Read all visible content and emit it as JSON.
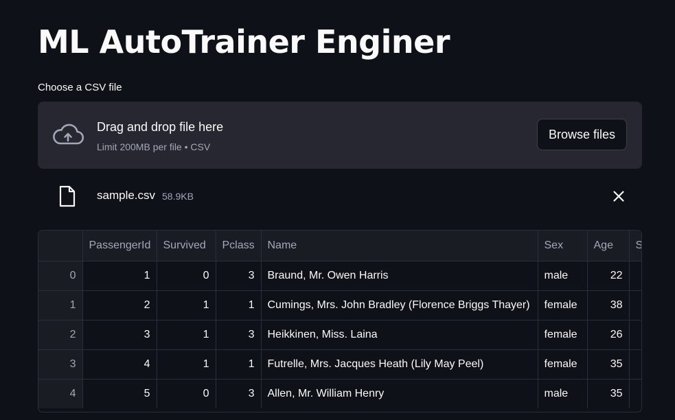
{
  "app": {
    "title": "ML AutoTrainer Enginer"
  },
  "uploader": {
    "label": "Choose a CSV file",
    "drop_title": "Drag and drop file here",
    "drop_subtitle": "Limit 200MB per file • CSV",
    "browse_label": "Browse files",
    "icon": "cloud-upload-icon"
  },
  "uploaded_file": {
    "name": "sample.csv",
    "size": "58.9KB",
    "icon": "file-icon",
    "remove_icon": "close-icon"
  },
  "table": {
    "columns": [
      "",
      "PassengerId",
      "Survived",
      "Pclass",
      "Name",
      "Sex",
      "Age",
      "S"
    ],
    "rows": [
      {
        "index": "0",
        "PassengerId": "1",
        "Survived": "0",
        "Pclass": "3",
        "Name": "Braund, Mr. Owen Harris",
        "Sex": "male",
        "Age": "22"
      },
      {
        "index": "1",
        "PassengerId": "2",
        "Survived": "1",
        "Pclass": "1",
        "Name": "Cumings, Mrs. John Bradley (Florence Briggs Thayer)",
        "Sex": "female",
        "Age": "38"
      },
      {
        "index": "2",
        "PassengerId": "3",
        "Survived": "1",
        "Pclass": "3",
        "Name": "Heikkinen, Miss. Laina",
        "Sex": "female",
        "Age": "26"
      },
      {
        "index": "3",
        "PassengerId": "4",
        "Survived": "1",
        "Pclass": "1",
        "Name": "Futrelle, Mrs. Jacques Heath (Lily May Peel)",
        "Sex": "female",
        "Age": "35"
      },
      {
        "index": "4",
        "PassengerId": "5",
        "Survived": "0",
        "Pclass": "3",
        "Name": "Allen, Mr. William Henry",
        "Sex": "male",
        "Age": "35"
      }
    ]
  },
  "colors": {
    "background": "#0e1117",
    "surface": "#262730",
    "text": "#fafafa",
    "muted": "#a3a8b8",
    "grid": "#2b2e38"
  }
}
